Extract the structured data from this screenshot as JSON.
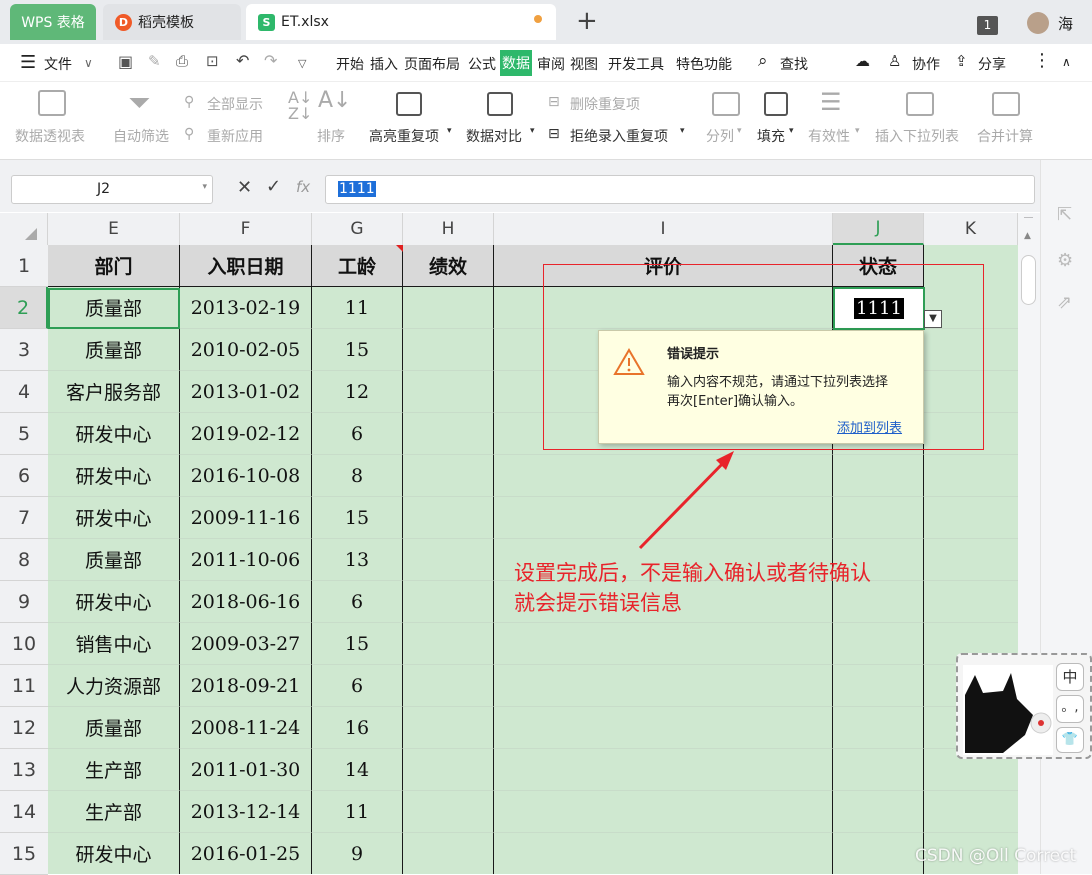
{
  "tabs": {
    "wps": "WPS 表格",
    "template": "稻壳模板",
    "file": "ET.xlsx",
    "page_indicator": "1",
    "user": "海"
  },
  "menu": {
    "file": "文件",
    "items": [
      "开始",
      "插入",
      "页面布局",
      "公式",
      "数据",
      "审阅",
      "视图",
      "开发工具",
      "特色功能"
    ],
    "search": "查找",
    "collab": "协作",
    "share": "分享"
  },
  "ribbon": {
    "pivot": "数据透视表",
    "autofilter": "自动筛选",
    "showall": "全部显示",
    "reapply": "重新应用",
    "sort": "排序",
    "highlight": "高亮重复项",
    "compare": "数据对比",
    "remove_dup": "删除重复项",
    "reject_dup": "拒绝录入重复项",
    "split": "分列",
    "fill": "填充",
    "validity": "有效性",
    "dropdown": "插入下拉列表",
    "consolidate": "合并计算"
  },
  "formula": {
    "cell_ref": "J2",
    "value": "1111",
    "fx": "fx"
  },
  "columns": [
    "E",
    "F",
    "G",
    "H",
    "I",
    "J",
    "K"
  ],
  "rows": [
    "1",
    "2",
    "3",
    "4",
    "5",
    "6",
    "7",
    "8",
    "9",
    "10",
    "11",
    "12",
    "13",
    "14",
    "15"
  ],
  "headers": [
    "部门",
    "入职日期",
    "工龄",
    "绩效",
    "评价",
    "状态"
  ],
  "table": [
    [
      "质量部",
      "2013-02-19",
      "11"
    ],
    [
      "质量部",
      "2010-02-05",
      "15"
    ],
    [
      "客户服务部",
      "2013-01-02",
      "12"
    ],
    [
      "研发中心",
      "2019-02-12",
      "6"
    ],
    [
      "研发中心",
      "2016-10-08",
      "8"
    ],
    [
      "研发中心",
      "2009-11-16",
      "15"
    ],
    [
      "质量部",
      "2011-10-06",
      "13"
    ],
    [
      "研发中心",
      "2018-06-16",
      "6"
    ],
    [
      "销售中心",
      "2009-03-27",
      "15"
    ],
    [
      "人力资源部",
      "2018-09-21",
      "6"
    ],
    [
      "质量部",
      "2008-11-24",
      "16"
    ],
    [
      "生产部",
      "2011-01-30",
      "14"
    ],
    [
      "生产部",
      "2013-12-14",
      "11"
    ],
    [
      "研发中心",
      "2016-01-25",
      "9"
    ]
  ],
  "active_cell_value": "1111",
  "error_popup": {
    "title": "错误提示",
    "line1": "输入内容不规范，请通过下拉列表选择",
    "line2": "再次[Enter]确认输入。",
    "link": "添加到列表"
  },
  "annotation": {
    "line1": "设置完成后，不是输入确认或者待确认",
    "line2": "就会提示错误信息"
  },
  "ime": {
    "lang": "中",
    "punct": "。,"
  },
  "watermark": "CSDN @Oll Correct",
  "colors": {
    "grid_bg": "#cfe8d0",
    "accent_green": "#5fb878",
    "annotation_red": "#e8242b"
  }
}
